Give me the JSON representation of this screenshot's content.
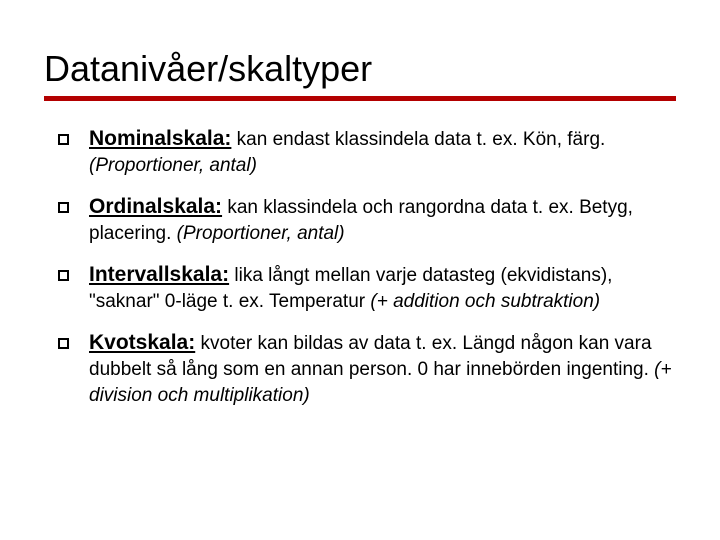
{
  "title": "Datanivåer/skaltyper",
  "items": [
    {
      "term": "Nominalskala:",
      "desc": " kan endast klassindela data t. ex. Kön, färg. ",
      "ital": "(Proportioner, antal)"
    },
    {
      "term": "Ordinalskala:",
      "desc": " kan klassindela och rangordna data t. ex. Betyg, placering. ",
      "ital": "(Proportioner, antal)"
    },
    {
      "term": "Intervallskala:",
      "desc": " lika långt  mellan varje datasteg (ekvidistans), \"saknar\" 0-läge t. ex. Temperatur ",
      "ital": "(+ addition och subtraktion)"
    },
    {
      "term": "Kvotskala:",
      "desc": " kvoter kan bildas av data t. ex. Längd någon kan vara dubbelt så lång som en annan person. 0 har innebörden ingenting. ",
      "ital": "(+ division och multiplikation)"
    }
  ]
}
